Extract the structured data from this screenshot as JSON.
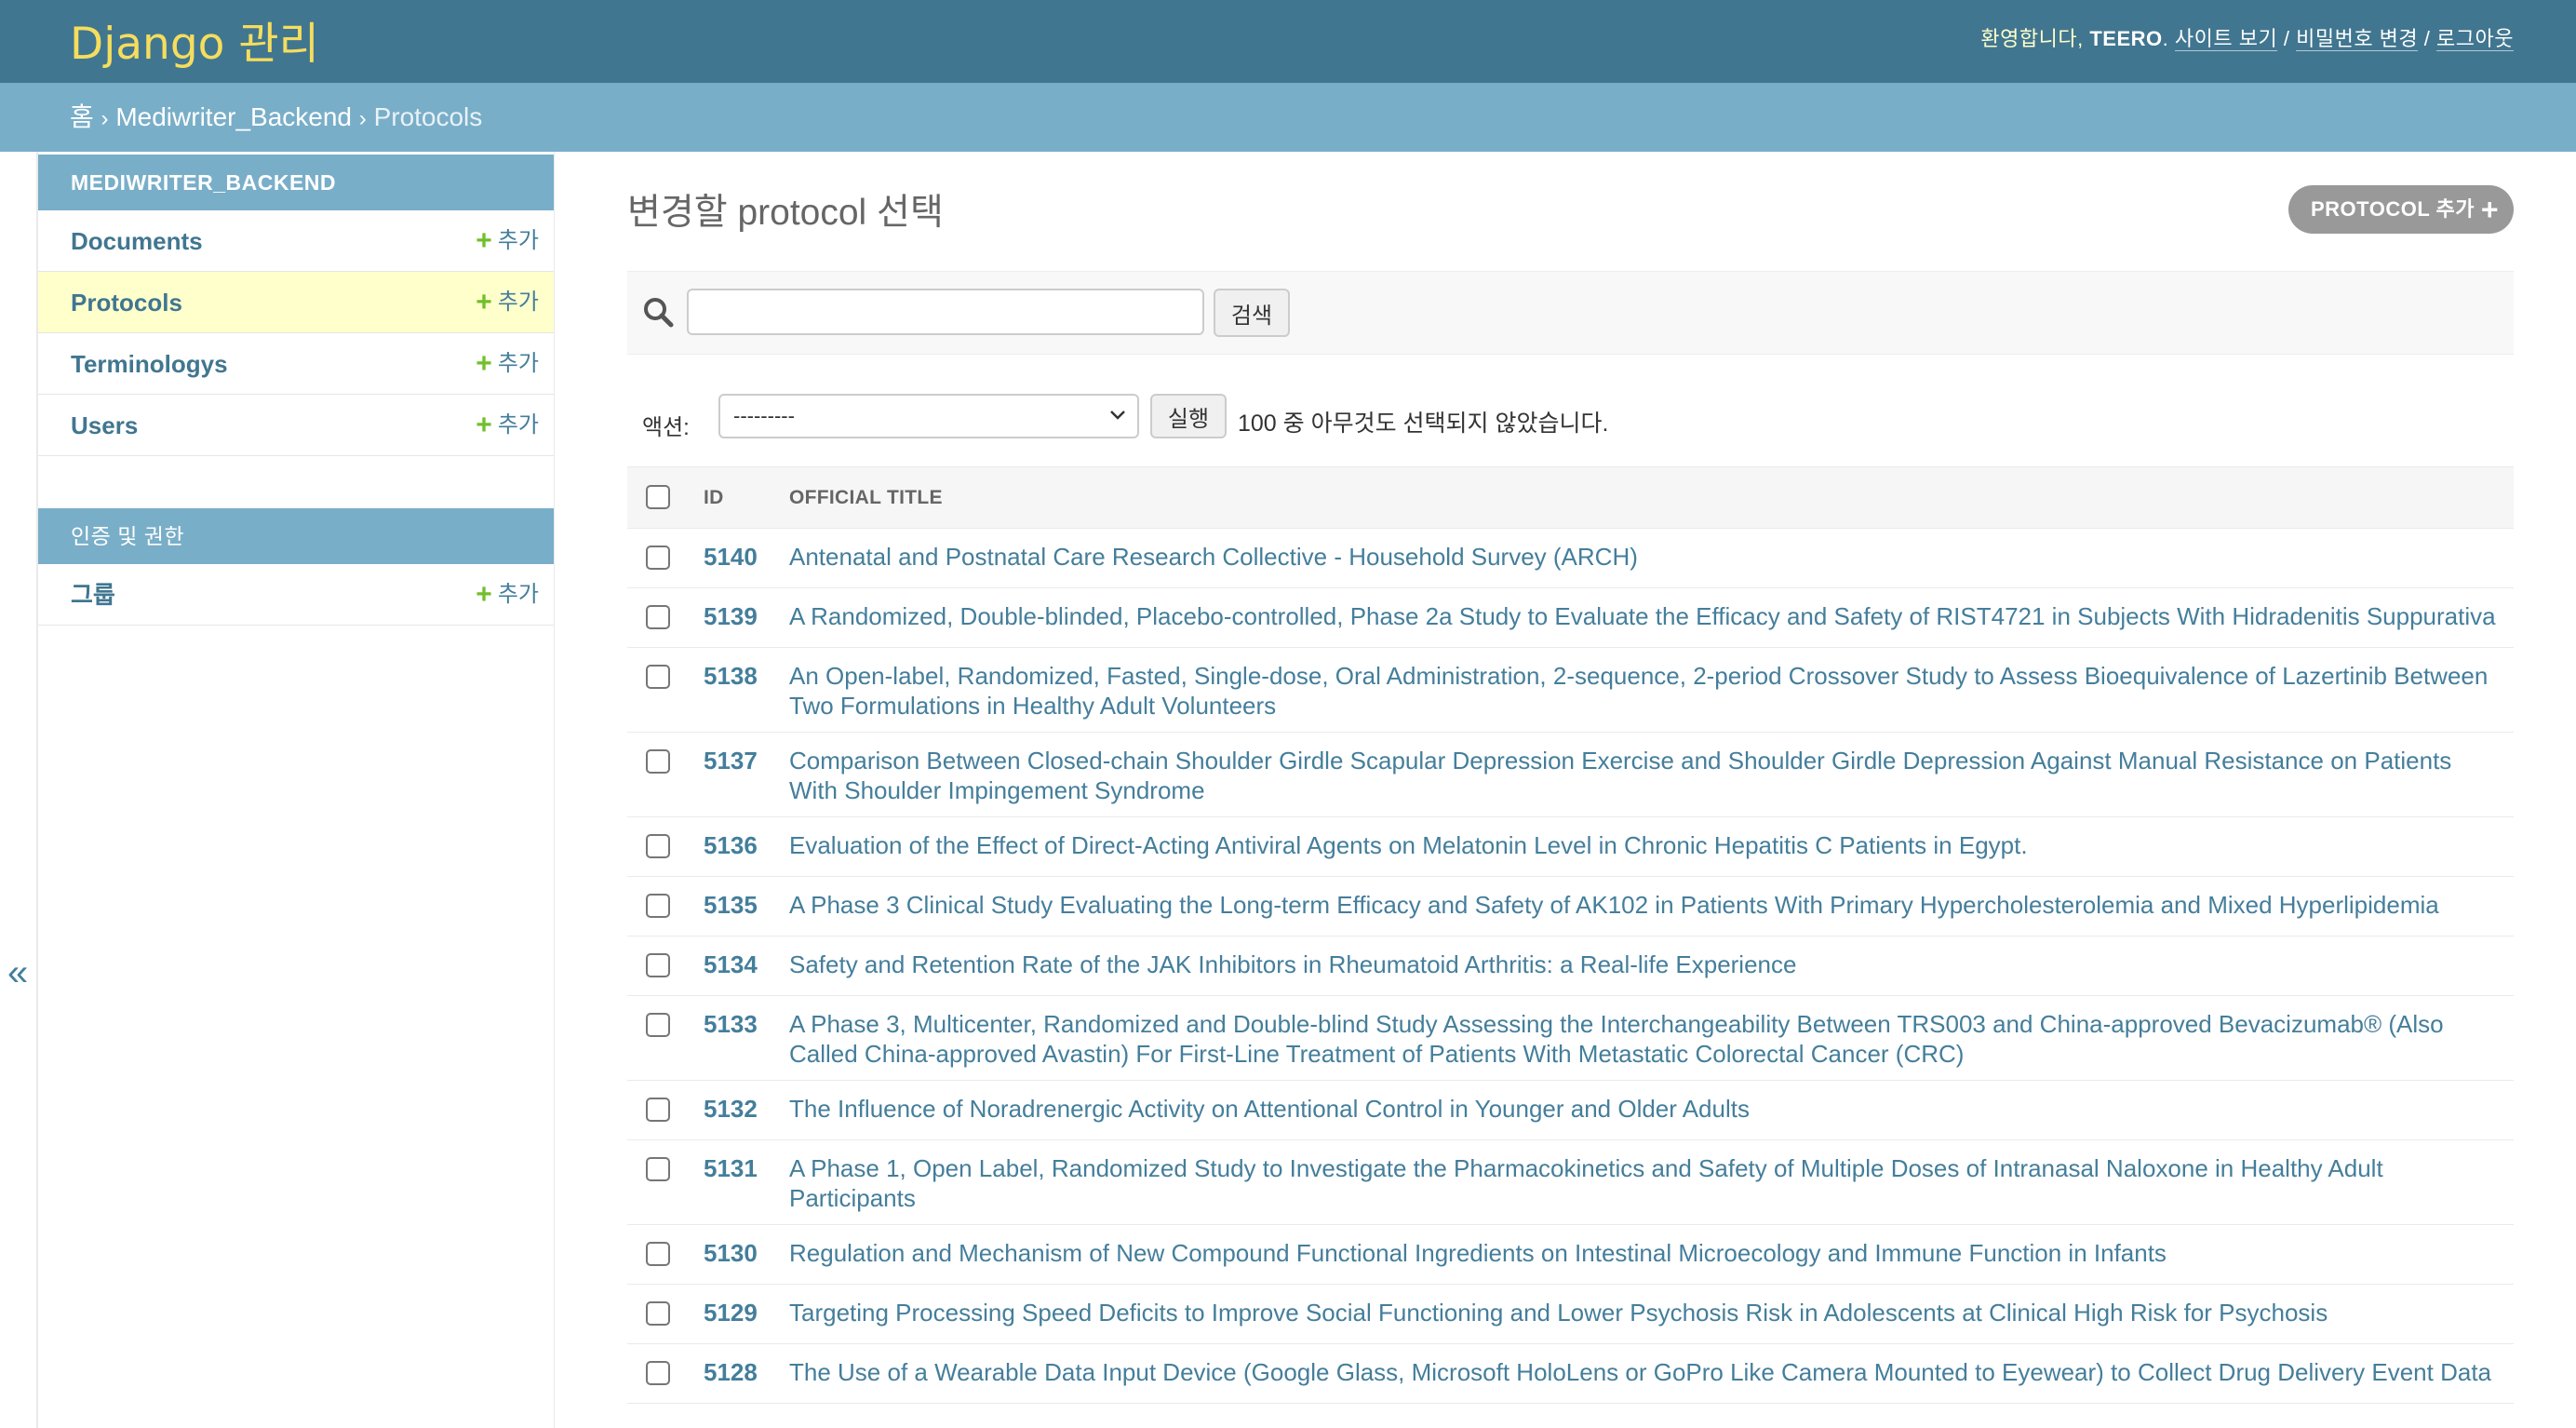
{
  "header": {
    "branding": "Django 관리",
    "welcome": "환영합니다,",
    "username": "TEERO",
    "view_site": "사이트 보기",
    "change_password": "비밀번호 변경",
    "logout": "로그아웃",
    "separator": "/",
    "dot": "."
  },
  "breadcrumbs": {
    "home": "홈",
    "app": "Mediwriter_Backend",
    "current": "Protocols",
    "separator": "›"
  },
  "sidebar": {
    "app_caption": "MEDIWRITER_BACKEND",
    "items": [
      {
        "label": "Documents",
        "add": "추가"
      },
      {
        "label": "Protocols",
        "add": "추가"
      },
      {
        "label": "Terminologys",
        "add": "추가"
      },
      {
        "label": "Users",
        "add": "추가"
      }
    ],
    "auth_caption": "인증 및 권한",
    "auth_items": [
      {
        "label": "그룹",
        "add": "추가"
      }
    ],
    "toggle": "«"
  },
  "content": {
    "title": "변경할 protocol 선택",
    "add_button": "PROTOCOL 추가",
    "search": {
      "button": "검색",
      "value": ""
    },
    "actions": {
      "label": "액션:",
      "selected": "---------",
      "run": "실행",
      "counter": "100 중 아무것도 선택되지 않았습니다."
    },
    "table": {
      "headers": [
        "ID",
        "OFFICIAL TITLE"
      ],
      "rows": [
        {
          "id": "5140",
          "title": "Antenatal and Postnatal Care Research Collective - Household Survey (ARCH)"
        },
        {
          "id": "5139",
          "title": "A Randomized, Double-blinded, Placebo-controlled, Phase 2a Study to Evaluate the Efficacy and Safety of RIST4721 in Subjects With Hidradenitis Suppurativa"
        },
        {
          "id": "5138",
          "title": "An Open-label, Randomized, Fasted, Single-dose, Oral Administration, 2-sequence, 2-period Crossover Study to Assess Bioequivalence of Lazertinib Between Two Formulations in Healthy Adult Volunteers"
        },
        {
          "id": "5137",
          "title": "Comparison Between Closed-chain Shoulder Girdle Scapular Depression Exercise and Shoulder Girdle Depression Against Manual Resistance on Patients With Shoulder Impingement Syndrome"
        },
        {
          "id": "5136",
          "title": "Evaluation of the Effect of Direct-Acting Antiviral Agents on Melatonin Level in Chronic Hepatitis C Patients in Egypt."
        },
        {
          "id": "5135",
          "title": "A Phase 3 Clinical Study Evaluating the Long-term Efficacy and Safety of AK102 in Patients With Primary Hypercholesterolemia and Mixed Hyperlipidemia"
        },
        {
          "id": "5134",
          "title": "Safety and Retention Rate of the JAK Inhibitors in Rheumatoid Arthritis: a Real-life Experience"
        },
        {
          "id": "5133",
          "title": "A Phase 3, Multicenter, Randomized and Double-blind Study Assessing the Interchangeability Between TRS003 and China-approved Bevacizumab® (Also Called China-approved Avastin) For First-Line Treatment of Patients With Metastatic Colorectal Cancer (CRC)"
        },
        {
          "id": "5132",
          "title": "The Influence of Noradrenergic Activity on Attentional Control in Younger and Older Adults"
        },
        {
          "id": "5131",
          "title": "A Phase 1, Open Label, Randomized Study to Investigate the Pharmacokinetics and Safety of Multiple Doses of Intranasal Naloxone in Healthy Adult Participants"
        },
        {
          "id": "5130",
          "title": "Regulation and Mechanism of New Compound Functional Ingredients on Intestinal Microecology and Immune Function in Infants"
        },
        {
          "id": "5129",
          "title": "Targeting Processing Speed Deficits to Improve Social Functioning and Lower Psychosis Risk in Adolescents at Clinical High Risk for Psychosis"
        },
        {
          "id": "5128",
          "title": "The Use of a Wearable Data Input Device (Google Glass, Microsoft HoloLens or GoPro Like Camera Mounted to Eyewear) to Collect Drug Delivery Event Data"
        }
      ]
    }
  },
  "colors": {
    "header_bg": "#417690",
    "breadcrumb_bg": "#79aec8",
    "branding": "#f5dd5d",
    "link": "#447e9b",
    "active_row": "#ffffcc",
    "add_plus": "#70bf2b"
  },
  "icons": {
    "search": "search-icon",
    "plus": "plus-icon",
    "collapse": "double-chevron-left-icon",
    "select_chevron": "chevron-down-icon"
  }
}
